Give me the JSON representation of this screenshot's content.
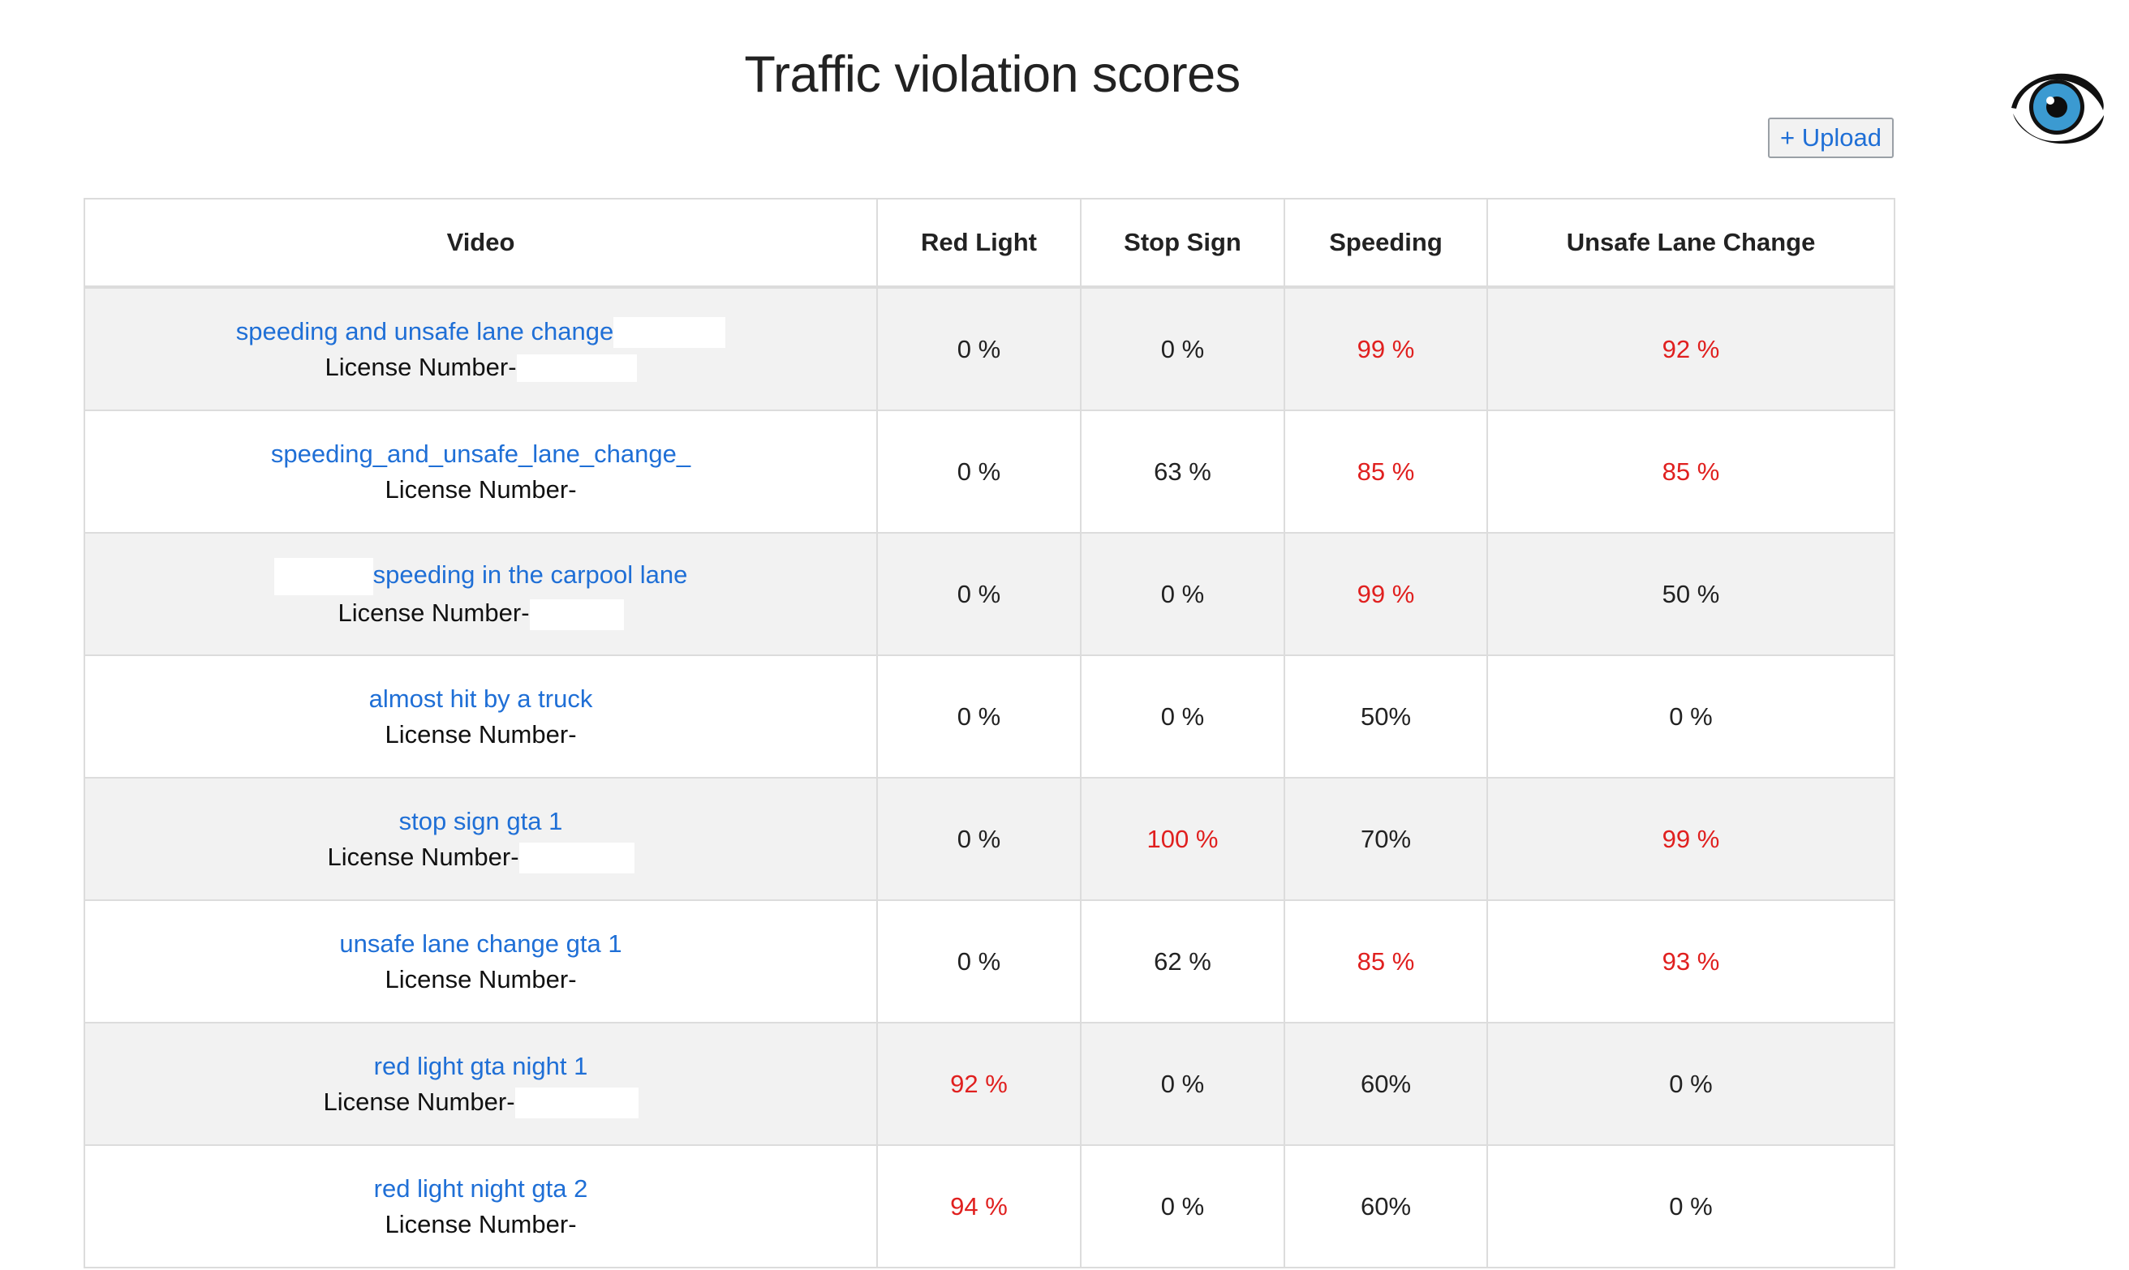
{
  "header": {
    "title": "Traffic violation scores",
    "upload_label": "+ Upload"
  },
  "logo": {
    "icon": "eye-icon",
    "iris_color": "#3b9ad1",
    "ring_color": "#111111"
  },
  "colors": {
    "link": "#1f6fd6",
    "alert": "#e0201f",
    "stripe": "#f2f2f2"
  },
  "table": {
    "columns": [
      "Video",
      "Red Light",
      "Stop Sign",
      "Speeding",
      "Unsafe Lane Change"
    ],
    "rows": [
      {
        "video": "speeding and unsafe lane change",
        "license_label": "License Number-",
        "red_light": "0 %",
        "stop_sign": "0 %",
        "speeding": "99 %",
        "unsafe_lane_change": "92 %",
        "flags": [
          false,
          false,
          true,
          true
        ]
      },
      {
        "video": "speeding_and_unsafe_lane_change_",
        "license_label": "License Number-",
        "red_light": "0 %",
        "stop_sign": "63 %",
        "speeding": "85 %",
        "unsafe_lane_change": "85 %",
        "flags": [
          false,
          false,
          true,
          true
        ]
      },
      {
        "video": "speeding in the carpool lane",
        "license_label": "License Number-",
        "red_light": "0 %",
        "stop_sign": "0 %",
        "speeding": "99 %",
        "unsafe_lane_change": "50 %",
        "flags": [
          false,
          false,
          true,
          false
        ]
      },
      {
        "video": "almost hit by a truck",
        "license_label": "License Number-",
        "red_light": "0 %",
        "stop_sign": "0 %",
        "speeding": "50%",
        "unsafe_lane_change": "0 %",
        "flags": [
          false,
          false,
          false,
          false
        ]
      },
      {
        "video": "stop sign gta 1",
        "license_label": "License Number-",
        "red_light": "0 %",
        "stop_sign": "100 %",
        "speeding": "70%",
        "unsafe_lane_change": "99 %",
        "flags": [
          false,
          true,
          false,
          true
        ]
      },
      {
        "video": "unsafe lane change gta 1",
        "license_label": "License Number-",
        "red_light": "0 %",
        "stop_sign": "62 %",
        "speeding": "85 %",
        "unsafe_lane_change": "93 %",
        "flags": [
          false,
          false,
          true,
          true
        ]
      },
      {
        "video": "red light gta night 1",
        "license_label": "License Number-",
        "red_light": "92 %",
        "stop_sign": "0 %",
        "speeding": "60%",
        "unsafe_lane_change": "0 %",
        "flags": [
          true,
          false,
          false,
          false
        ]
      },
      {
        "video": "red light night gta 2",
        "license_label": "License Number-",
        "red_light": "94 %",
        "stop_sign": "0 %",
        "speeding": "60%",
        "unsafe_lane_change": "0 %",
        "flags": [
          true,
          false,
          false,
          false
        ]
      }
    ]
  }
}
